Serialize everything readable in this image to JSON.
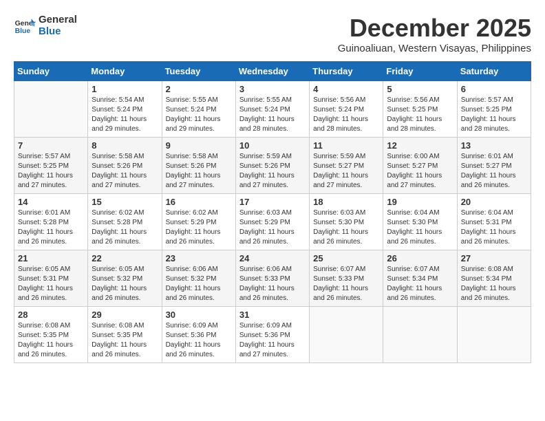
{
  "header": {
    "logo_line1": "General",
    "logo_line2": "Blue",
    "month": "December 2025",
    "location": "Guinoaliuan, Western Visayas, Philippines"
  },
  "days_of_week": [
    "Sunday",
    "Monday",
    "Tuesday",
    "Wednesday",
    "Thursday",
    "Friday",
    "Saturday"
  ],
  "weeks": [
    [
      {
        "day": "",
        "info": ""
      },
      {
        "day": "1",
        "info": "Sunrise: 5:54 AM\nSunset: 5:24 PM\nDaylight: 11 hours\nand 29 minutes."
      },
      {
        "day": "2",
        "info": "Sunrise: 5:55 AM\nSunset: 5:24 PM\nDaylight: 11 hours\nand 29 minutes."
      },
      {
        "day": "3",
        "info": "Sunrise: 5:55 AM\nSunset: 5:24 PM\nDaylight: 11 hours\nand 28 minutes."
      },
      {
        "day": "4",
        "info": "Sunrise: 5:56 AM\nSunset: 5:24 PM\nDaylight: 11 hours\nand 28 minutes."
      },
      {
        "day": "5",
        "info": "Sunrise: 5:56 AM\nSunset: 5:25 PM\nDaylight: 11 hours\nand 28 minutes."
      },
      {
        "day": "6",
        "info": "Sunrise: 5:57 AM\nSunset: 5:25 PM\nDaylight: 11 hours\nand 28 minutes."
      }
    ],
    [
      {
        "day": "7",
        "info": "Sunrise: 5:57 AM\nSunset: 5:25 PM\nDaylight: 11 hours\nand 27 minutes."
      },
      {
        "day": "8",
        "info": "Sunrise: 5:58 AM\nSunset: 5:26 PM\nDaylight: 11 hours\nand 27 minutes."
      },
      {
        "day": "9",
        "info": "Sunrise: 5:58 AM\nSunset: 5:26 PM\nDaylight: 11 hours\nand 27 minutes."
      },
      {
        "day": "10",
        "info": "Sunrise: 5:59 AM\nSunset: 5:26 PM\nDaylight: 11 hours\nand 27 minutes."
      },
      {
        "day": "11",
        "info": "Sunrise: 5:59 AM\nSunset: 5:27 PM\nDaylight: 11 hours\nand 27 minutes."
      },
      {
        "day": "12",
        "info": "Sunrise: 6:00 AM\nSunset: 5:27 PM\nDaylight: 11 hours\nand 27 minutes."
      },
      {
        "day": "13",
        "info": "Sunrise: 6:01 AM\nSunset: 5:27 PM\nDaylight: 11 hours\nand 26 minutes."
      }
    ],
    [
      {
        "day": "14",
        "info": "Sunrise: 6:01 AM\nSunset: 5:28 PM\nDaylight: 11 hours\nand 26 minutes."
      },
      {
        "day": "15",
        "info": "Sunrise: 6:02 AM\nSunset: 5:28 PM\nDaylight: 11 hours\nand 26 minutes."
      },
      {
        "day": "16",
        "info": "Sunrise: 6:02 AM\nSunset: 5:29 PM\nDaylight: 11 hours\nand 26 minutes."
      },
      {
        "day": "17",
        "info": "Sunrise: 6:03 AM\nSunset: 5:29 PM\nDaylight: 11 hours\nand 26 minutes."
      },
      {
        "day": "18",
        "info": "Sunrise: 6:03 AM\nSunset: 5:30 PM\nDaylight: 11 hours\nand 26 minutes."
      },
      {
        "day": "19",
        "info": "Sunrise: 6:04 AM\nSunset: 5:30 PM\nDaylight: 11 hours\nand 26 minutes."
      },
      {
        "day": "20",
        "info": "Sunrise: 6:04 AM\nSunset: 5:31 PM\nDaylight: 11 hours\nand 26 minutes."
      }
    ],
    [
      {
        "day": "21",
        "info": "Sunrise: 6:05 AM\nSunset: 5:31 PM\nDaylight: 11 hours\nand 26 minutes."
      },
      {
        "day": "22",
        "info": "Sunrise: 6:05 AM\nSunset: 5:32 PM\nDaylight: 11 hours\nand 26 minutes."
      },
      {
        "day": "23",
        "info": "Sunrise: 6:06 AM\nSunset: 5:32 PM\nDaylight: 11 hours\nand 26 minutes."
      },
      {
        "day": "24",
        "info": "Sunrise: 6:06 AM\nSunset: 5:33 PM\nDaylight: 11 hours\nand 26 minutes."
      },
      {
        "day": "25",
        "info": "Sunrise: 6:07 AM\nSunset: 5:33 PM\nDaylight: 11 hours\nand 26 minutes."
      },
      {
        "day": "26",
        "info": "Sunrise: 6:07 AM\nSunset: 5:34 PM\nDaylight: 11 hours\nand 26 minutes."
      },
      {
        "day": "27",
        "info": "Sunrise: 6:08 AM\nSunset: 5:34 PM\nDaylight: 11 hours\nand 26 minutes."
      }
    ],
    [
      {
        "day": "28",
        "info": "Sunrise: 6:08 AM\nSunset: 5:35 PM\nDaylight: 11 hours\nand 26 minutes."
      },
      {
        "day": "29",
        "info": "Sunrise: 6:08 AM\nSunset: 5:35 PM\nDaylight: 11 hours\nand 26 minutes."
      },
      {
        "day": "30",
        "info": "Sunrise: 6:09 AM\nSunset: 5:36 PM\nDaylight: 11 hours\nand 26 minutes."
      },
      {
        "day": "31",
        "info": "Sunrise: 6:09 AM\nSunset: 5:36 PM\nDaylight: 11 hours\nand 27 minutes."
      },
      {
        "day": "",
        "info": ""
      },
      {
        "day": "",
        "info": ""
      },
      {
        "day": "",
        "info": ""
      }
    ]
  ]
}
